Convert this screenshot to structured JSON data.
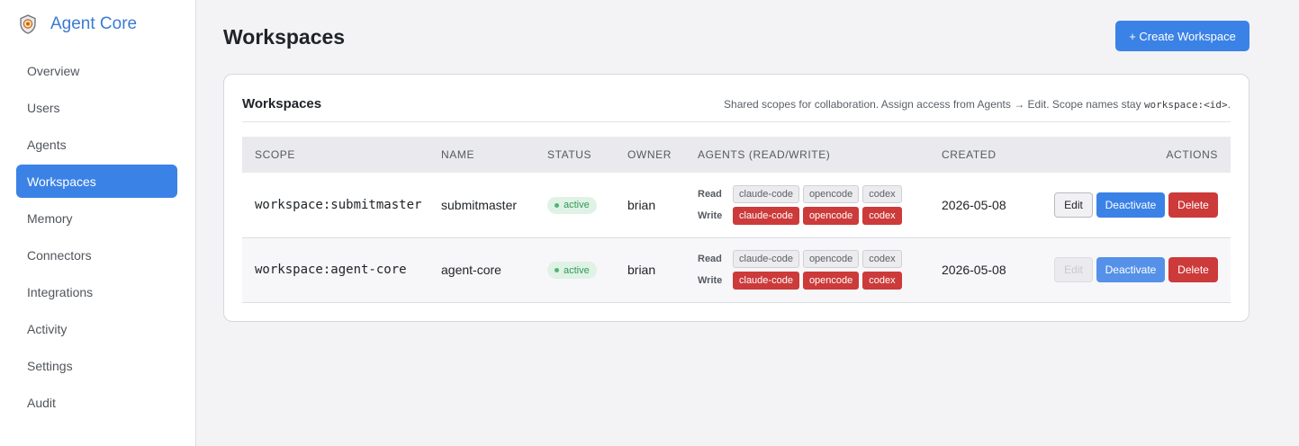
{
  "app": {
    "name": "Agent Core",
    "logo_icon": "shield-icon"
  },
  "sidebar": {
    "items": [
      {
        "label": "Overview",
        "active": false
      },
      {
        "label": "Users",
        "active": false
      },
      {
        "label": "Agents",
        "active": false
      },
      {
        "label": "Workspaces",
        "active": true
      },
      {
        "label": "Memory",
        "active": false
      },
      {
        "label": "Connectors",
        "active": false
      },
      {
        "label": "Integrations",
        "active": false
      },
      {
        "label": "Activity",
        "active": false
      },
      {
        "label": "Settings",
        "active": false
      },
      {
        "label": "Audit",
        "active": false
      }
    ]
  },
  "page": {
    "title": "Workspaces",
    "create_button": "+ Create Workspace"
  },
  "card": {
    "title": "Workspaces",
    "description": "Shared scopes for collaboration. Assign access from Agents → Edit. Scope names stay ",
    "description_code": "workspace:<id>",
    "description_end": "."
  },
  "table": {
    "headers": {
      "scope": "Scope",
      "name": "Name",
      "status": "Status",
      "owner": "Owner",
      "agents": "Agents (Read/Write)",
      "created": "Created",
      "actions": "Actions"
    },
    "read_label": "Read",
    "write_label": "Write",
    "rows": [
      {
        "scope": "workspace:submitmaster",
        "name": "submitmaster",
        "status": "active",
        "owner": "brian",
        "read": [
          "claude-code",
          "opencode",
          "codex"
        ],
        "write": [
          "claude-code",
          "opencode",
          "codex"
        ],
        "created": "2026-05-08",
        "edit": "Edit",
        "deactivate": "Deactivate",
        "delete": "Delete"
      },
      {
        "scope": "workspace:agent-core",
        "name": "agent-core",
        "status": "active",
        "owner": "brian",
        "read": [
          "claude-code",
          "opencode",
          "codex"
        ],
        "write": [
          "claude-code",
          "opencode",
          "codex"
        ],
        "created": "2026-05-08",
        "edit": "Edit",
        "deactivate": "Deactivate",
        "delete": "Delete"
      }
    ]
  },
  "colors": {
    "accent": "#3b82e6",
    "danger": "#cc3a3a",
    "success": "#2f9a57"
  }
}
